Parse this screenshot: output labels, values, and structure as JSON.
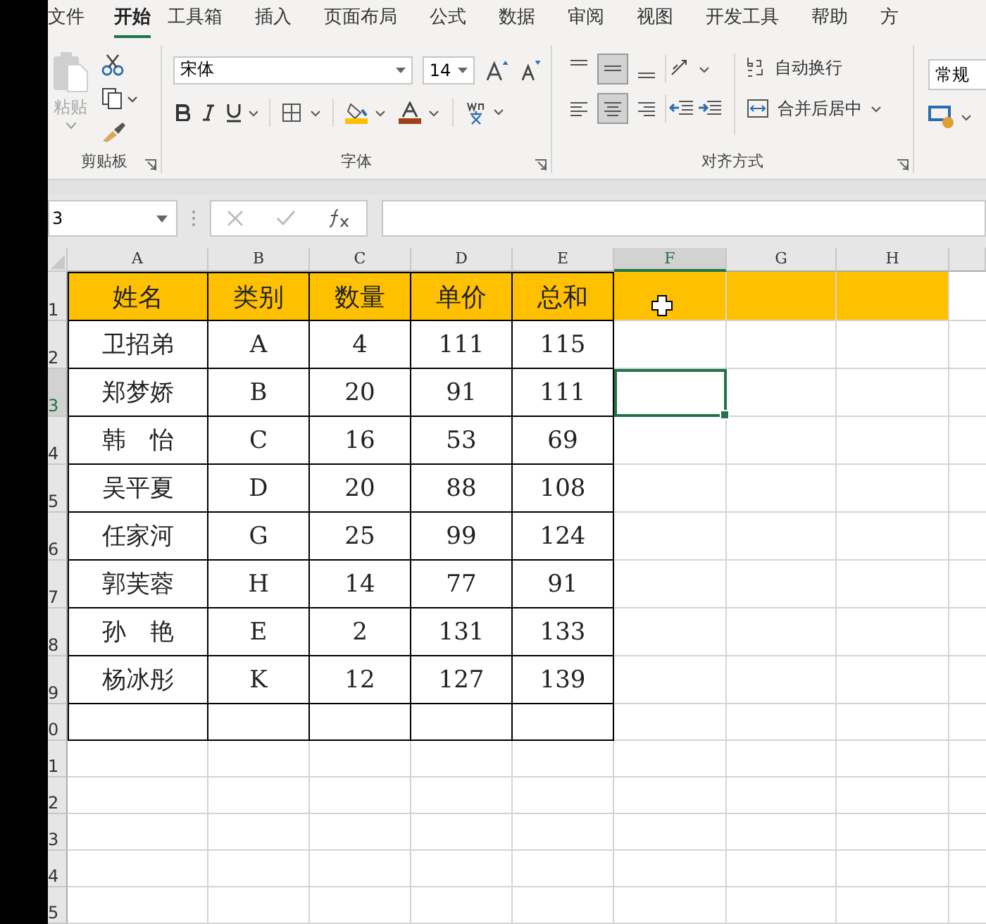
{
  "tabs": [
    {
      "label": "文件",
      "selected": false
    },
    {
      "label": "开始",
      "selected": true
    },
    {
      "label": "工具箱",
      "selected": false
    },
    {
      "label": "插入",
      "selected": false
    },
    {
      "label": "页面布局",
      "selected": false
    },
    {
      "label": "公式",
      "selected": false
    },
    {
      "label": "数据",
      "selected": false
    },
    {
      "label": "审阅",
      "selected": false
    },
    {
      "label": "视图",
      "selected": false
    },
    {
      "label": "开发工具",
      "selected": false
    },
    {
      "label": "帮助",
      "selected": false
    },
    {
      "label": "方",
      "selected": false
    }
  ],
  "ribbon": {
    "clipboard": {
      "paste_label": "粘贴",
      "paste_disabled": true,
      "group_label": "剪贴板"
    },
    "font": {
      "font_name": "宋体",
      "font_size": "14",
      "group_label": "字体"
    },
    "alignment": {
      "vertical": [
        {
          "kind": "top",
          "selected": false
        },
        {
          "kind": "middle",
          "selected": true
        },
        {
          "kind": "bottom",
          "selected": false
        }
      ],
      "horizontal": [
        {
          "kind": "left",
          "selected": false
        },
        {
          "kind": "center",
          "selected": true
        },
        {
          "kind": "right",
          "selected": false
        }
      ],
      "wrap_label": "自动换行",
      "merge_label": "合并后居中",
      "group_label": "对齐方式"
    },
    "number": {
      "format": "常规"
    }
  },
  "formula_bar": {
    "name_box": "3"
  },
  "sheet": {
    "columns": [
      {
        "label": "A",
        "selected": false
      },
      {
        "label": "B",
        "selected": false
      },
      {
        "label": "C",
        "selected": false
      },
      {
        "label": "D",
        "selected": false
      },
      {
        "label": "E",
        "selected": false
      },
      {
        "label": "F",
        "selected": true
      },
      {
        "label": "G",
        "selected": false
      },
      {
        "label": "H",
        "selected": false
      }
    ],
    "rows": [
      {
        "header": "1",
        "selected": false,
        "kind": "heading",
        "in_table": true,
        "cells": [
          "姓名",
          "类别",
          "数量",
          "单价",
          "总和"
        ]
      },
      {
        "header": "2",
        "selected": false,
        "kind": "data",
        "in_table": true,
        "cells": [
          "卫招弟",
          "A",
          "4",
          "111",
          "115"
        ]
      },
      {
        "header": "3",
        "selected": true,
        "kind": "data",
        "in_table": true,
        "cells": [
          "郑梦娇",
          "B",
          "20",
          "91",
          "111"
        ]
      },
      {
        "header": "4",
        "selected": false,
        "kind": "data",
        "in_table": true,
        "cells": [
          "韩　怡",
          "C",
          "16",
          "53",
          "69"
        ]
      },
      {
        "header": "5",
        "selected": false,
        "kind": "data",
        "in_table": true,
        "cells": [
          "吴平夏",
          "D",
          "20",
          "88",
          "108"
        ]
      },
      {
        "header": "6",
        "selected": false,
        "kind": "data",
        "in_table": true,
        "cells": [
          "任家河",
          "G",
          "25",
          "99",
          "124"
        ]
      },
      {
        "header": "7",
        "selected": false,
        "kind": "data",
        "in_table": true,
        "cells": [
          "郭芙蓉",
          "H",
          "14",
          "77",
          "91"
        ]
      },
      {
        "header": "8",
        "selected": false,
        "kind": "data",
        "in_table": true,
        "cells": [
          "孙　艳",
          "E",
          "2",
          "131",
          "133"
        ]
      },
      {
        "header": "9",
        "selected": false,
        "kind": "data",
        "in_table": true,
        "cells": [
          "杨冰彤",
          "K",
          "12",
          "127",
          "139"
        ]
      },
      {
        "header": "0",
        "selected": false,
        "kind": "data",
        "in_table": true
      },
      {
        "header": "1",
        "selected": false,
        "kind": "data",
        "in_table": false
      },
      {
        "header": "2",
        "selected": false,
        "kind": "data",
        "in_table": false
      },
      {
        "header": "3",
        "selected": false,
        "kind": "data",
        "in_table": false
      },
      {
        "header": "4",
        "selected": false,
        "kind": "data",
        "in_table": false
      },
      {
        "header": "5",
        "selected": false,
        "kind": "data",
        "in_table": false
      }
    ]
  }
}
